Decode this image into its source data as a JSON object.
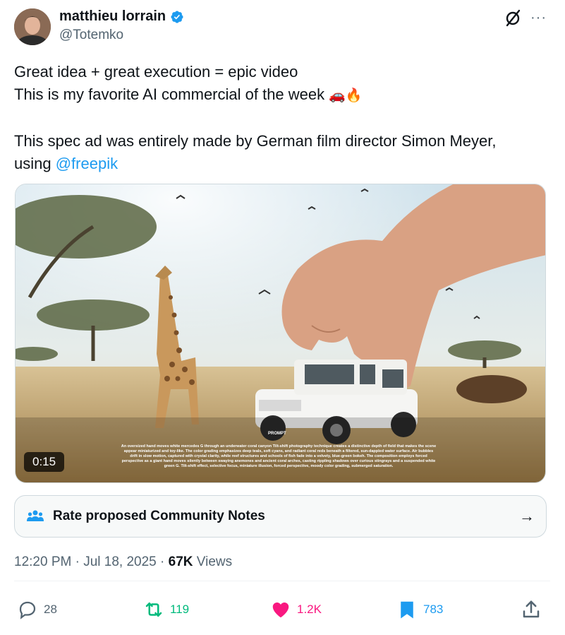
{
  "author": {
    "display_name": "matthieu lorrain",
    "handle": "@Totemko",
    "verified": true
  },
  "tweet": {
    "line1": "Great idea + great execution = epic video",
    "line2": "This is my favorite AI commercial of the week",
    "line2_emojis": "🚗🔥",
    "line3": "This spec ad was entirely made by German film director  Simon Meyer,",
    "line4_prefix": "using ",
    "mention": "@freepik"
  },
  "media": {
    "duration": "0:15",
    "prompt_label": "PROMPT",
    "prompt_text": "An oversized hand moves white mercedes G through an underwater coral canyon Tilt-shift photography technique creates a distinctive depth of field that makes the scene appear miniaturized and toy-like. The color grading emphasizes deep teals, soft cyans, and radiant coral reds beneath a filtered, sun-dappled water surface. Air bubbles drift in slow motion, captured with crystal clarity, while reef structures and schools of fish fade into a velvety, blue-green bokeh. The composition employs forced perspective as a giant hand moves silently between swaying anemones and ancient coral arches, casting rippling shadows over curious stingrays and a suspended white green G. Tilt-shift effect, selective focus, miniature illusion, forced perspective, moody color grading, submerged saturation."
  },
  "community_notes": {
    "label": "Rate proposed Community Notes",
    "arrow": "→"
  },
  "meta": {
    "time": "12:20 PM",
    "separator": " · ",
    "date": "Jul 18, 2025",
    "views_count": "67K",
    "views_label": " Views"
  },
  "actions": {
    "replies": "28",
    "reposts": "119",
    "likes": "1.2K",
    "bookmarks": "783"
  },
  "icons": [
    "verified-badge-icon",
    "grok-icon",
    "more-icon",
    "community-notes-icon",
    "arrow-right-icon",
    "reply-icon",
    "repost-icon",
    "like-icon",
    "bookmark-icon",
    "share-icon"
  ],
  "colors": {
    "accent": "#1d9bf0",
    "text": "#0f1419",
    "secondary": "#536471",
    "repost": "#00ba7c",
    "like": "#f91880"
  }
}
